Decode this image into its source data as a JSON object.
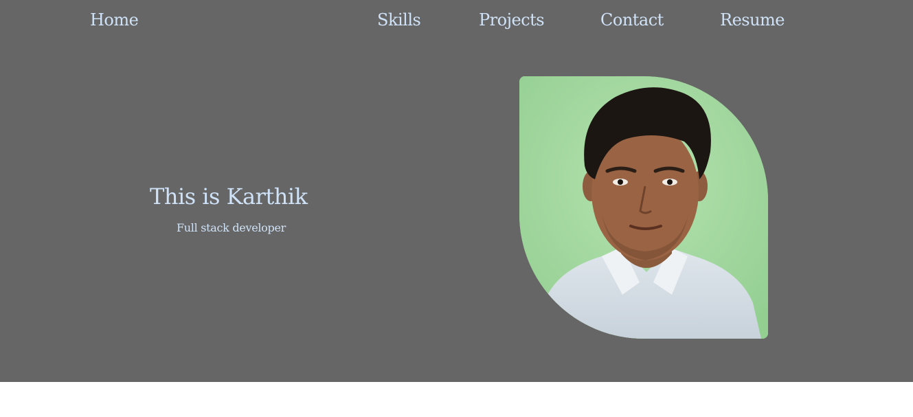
{
  "nav": {
    "items": [
      {
        "id": "home",
        "label": "Home"
      },
      {
        "id": "skills",
        "label": "Skills"
      },
      {
        "id": "projects",
        "label": "Projects"
      },
      {
        "id": "contact",
        "label": "Contact"
      },
      {
        "id": "resume",
        "label": "Resume"
      }
    ]
  },
  "hero": {
    "title": "This is Karthik",
    "subtitle": "Full stack developer"
  },
  "colors": {
    "hero_background": "#666666",
    "text_accent": "#cfe2f7",
    "page_background": "#ffffff",
    "photo_background": "#a3d9a0"
  }
}
